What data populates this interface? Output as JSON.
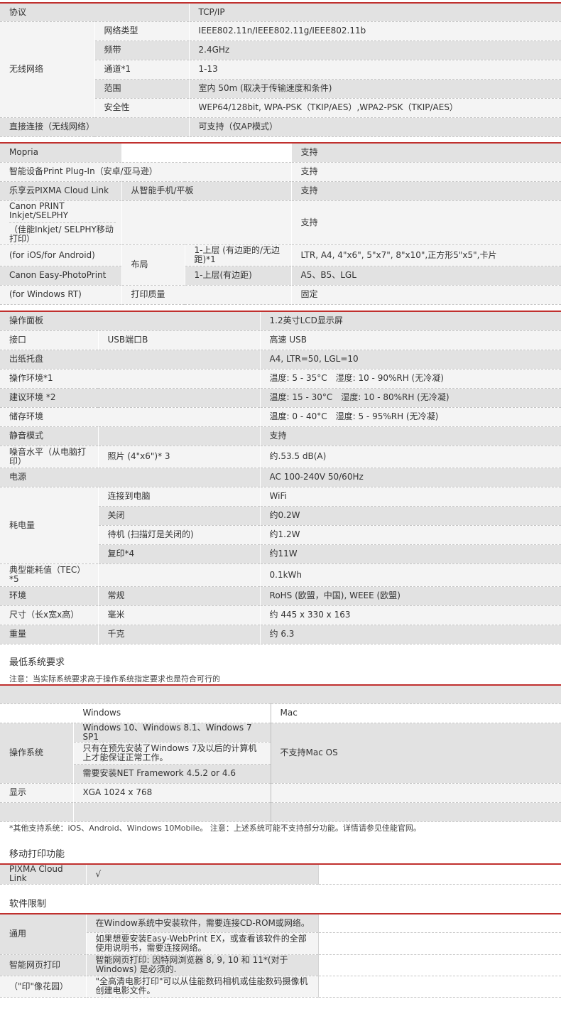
{
  "network": {
    "protocol_label": "协议",
    "protocol_value": "TCP/IP",
    "wireless_label": "无线网络",
    "net_type_label": "网络类型",
    "net_type_value": "IEEE802.11n/IEEE802.11g/IEEE802.11b",
    "band_label": "频带",
    "band_value": "2.4GHz",
    "channel_label": "通道*1",
    "channel_value": "1-13",
    "range_label": "范围",
    "range_value": "室内 50m (取决于传输速度和条件)",
    "security_label": "安全性",
    "security_value": "WEP64/128bit, WPA-PSK（TKIP/AES）,WPA2-PSK（TKIP/AES）",
    "direct_label": "直接连接（无线网络）",
    "direct_value": "可支持（仅AP模式）"
  },
  "mobile": {
    "mopria_label": "Mopria",
    "mopria_value": "支持",
    "plugin_label": "智能设备Print Plug-In（安卓/亚马逊）",
    "plugin_value": "支持",
    "cloud_label": "乐享云PIXMA Cloud Link",
    "cloud_sub": "从智能手机/平板",
    "cloud_value": "支持",
    "canon_print_label": "Canon PRINT Inkjet/SELPHY",
    "canon_print_sub": "（佳能Inkjet/ SELPHY移动打印）",
    "canon_print_value": "支持",
    "ios_label": "(for iOS/for Android)",
    "layout_label": "布局",
    "layer1_label": "1-上层 (有边距的/无边距)*1",
    "layer1_value": "LTR, A4, 4\"x6\", 5\"x7\", 8\"x10\",正方形5\"x5\",卡片",
    "easyphoto_label": "Canon Easy-PhotoPrint",
    "layer2_label": "1-上层(有边距)",
    "layer2_value": "A5、B5、LGL",
    "winrt_label": "(for Windows RT)",
    "quality_label": "打印质量",
    "quality_value": "固定"
  },
  "general": {
    "panel_label": "操作面板",
    "panel_value": "1.2英寸LCD显示屏",
    "interface_label": "接口",
    "interface_sub": "USB端口B",
    "interface_value": "高速 USB",
    "tray_label": "出纸托盘",
    "tray_value": "A4, LTR=50, LGL=10",
    "op_env_label": "操作环境*1",
    "op_env_value": "温度: 5 - 35°C　湿度: 10 - 90%RH (无冷凝)",
    "rec_env_label": "建议环境 *2",
    "rec_env_value": "温度: 15 - 30°C　湿度: 10 - 80%RH (无冷凝)",
    "storage_label": "储存环境",
    "storage_value": "温度: 0 - 40°C　湿度: 5 - 95%RH (无冷凝)",
    "quiet_label": "静音模式",
    "quiet_value": "支持",
    "noise_label": "噪音水平（从电脑打印）",
    "noise_sub": "照片 (4\"x6\")* 3",
    "noise_value": "约.53.5 dB(A)",
    "power_label": "电源",
    "power_value": "AC 100-240V 50/60Hz",
    "consumption_label": "耗电量",
    "pc_label": "连接到电脑",
    "pc_value": "WiFi",
    "off_label": "关闭",
    "off_value": "约0.2W",
    "standby_label": "待机 (扫描灯是关闭的)",
    "standby_value": "约1.2W",
    "copy_label": "复印*4",
    "copy_value": "约11W",
    "tec_label": "典型能耗值（TEC）*5",
    "tec_value": "0.1kWh",
    "environment_label": "环境",
    "environment_sub": "常规",
    "environment_value": "RoHS (欧盟，中国), WEEE (欧盟)",
    "size_label": "尺寸（长x宽x高）",
    "size_sub": "毫米",
    "size_value": "约 445 x 330 x 163",
    "weight_label": "重量",
    "weight_sub": "千克",
    "weight_value": "约 6.3"
  },
  "sysreq": {
    "title": "最低系统要求",
    "note": "注意：当实际系统要求高于操作系统指定要求也是符合可行的",
    "windows_header": "Windows",
    "mac_header": "Mac",
    "os_label": "操作系统",
    "win_versions": "Windows 10、Windows 8.1、Windows 7 SP1",
    "win_note": "只有在预先安装了Windows 7及以后的计算机上才能保证正常工作。",
    "net_framework": "需要安装NET Framework 4.5.2 or 4.6",
    "mac_value": "不支持Mac OS",
    "display_label": "显示",
    "display_value": "XGA 1024 x 768",
    "footnote": "*其他支持系统：iOS、Android、Windows 10Mobile。 注意：上述系统可能不支持部分功能。详情请参见佳能官网。"
  },
  "mobile_print": {
    "title": "移动打印功能",
    "cloud_label": "PIXMA Cloud Link",
    "cloud_value": "√"
  },
  "software": {
    "title": "软件限制",
    "general_label": "通用",
    "general_value1": "在Window系统中安装软件，需要连接CD-ROM或网络。",
    "general_value2": "如果想要安装Easy-WebPrint EX，或查看该软件的全部使用说明书，需要连接网络。",
    "web_label": "智能网页打印",
    "web_value": "智能网页打印: 因特网浏览器 8, 9, 10 和 11*(对于Windows) 是必须的.",
    "garden_label": "（\"印\"像花园）",
    "garden_value": "\"全高清电影打印\"可以从佳能数码相机或佳能数码摄像机创建电影文件。"
  },
  "colors": {
    "accent_rule": "#c0302e",
    "row_dark": "#e2e2e2",
    "row_light": "#f4f4f4"
  }
}
